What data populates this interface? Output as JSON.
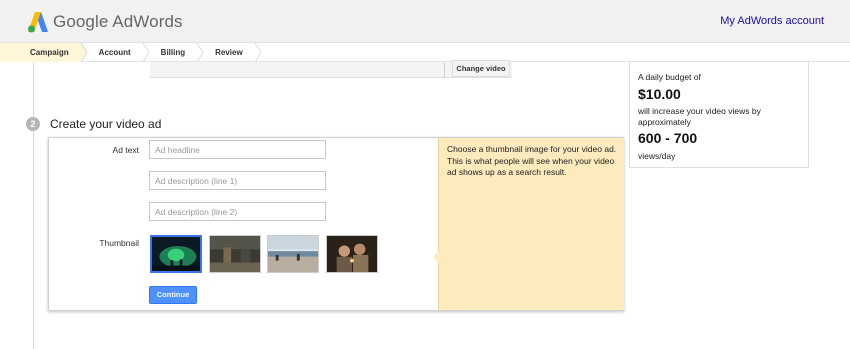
{
  "header": {
    "logo_text": "Google AdWords",
    "account_link": "My AdWords account"
  },
  "breadcrumb": {
    "items": [
      {
        "label": "Campaign",
        "active": true
      },
      {
        "label": "Account",
        "active": false
      },
      {
        "label": "Billing",
        "active": false
      },
      {
        "label": "Review",
        "active": false
      }
    ]
  },
  "previous_step": {
    "change_video_label": "Change video"
  },
  "step": {
    "number": "2",
    "title": "Create your video ad"
  },
  "form": {
    "ad_text_label": "Ad text",
    "headline_placeholder": "Ad headline",
    "desc1_placeholder": "Ad description (line 1)",
    "desc2_placeholder": "Ad description (line 2)",
    "thumbnail_label": "Thumbnail",
    "thumbnails": [
      {
        "icon": "concert-thumbnail",
        "selected": true
      },
      {
        "icon": "street-thumbnail",
        "selected": false
      },
      {
        "icon": "beach-thumbnail",
        "selected": false
      },
      {
        "icon": "people-thumbnail",
        "selected": false
      }
    ],
    "continue_label": "Continue"
  },
  "tip": {
    "text": "Choose a thumbnail image for your video ad. This is what people will see when your video ad shows up as a search result."
  },
  "budget": {
    "intro": "A daily budget of",
    "amount": "$10.00",
    "middle": "will increase your video views by approximately",
    "range": "600 - 700",
    "unit": "views/day"
  },
  "colors": {
    "accent_blue": "#4d90fe",
    "tip_background": "#fdebbe",
    "active_crumb": "#fdf6d9"
  }
}
